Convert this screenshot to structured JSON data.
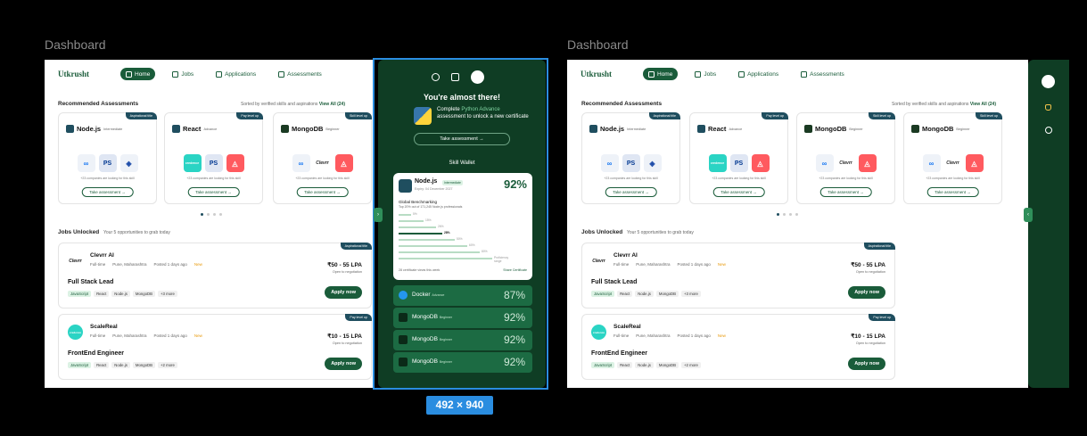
{
  "canvas_labels": [
    "Dashboard",
    "Dashboard"
  ],
  "dimension_badge": "492 × 940",
  "nav": {
    "logo": "Utkrusht",
    "items": [
      {
        "label": "Home",
        "active": true
      },
      {
        "label": "Jobs"
      },
      {
        "label": "Applications"
      },
      {
        "label": "Assessments"
      }
    ]
  },
  "recommended": {
    "title": "Recommended Assessments",
    "subtitle": "Sorted by verified skills and aspirations",
    "view_all": "View All (24)",
    "cards": [
      {
        "tag": "Aspirational title",
        "name": "Node.js",
        "level": "Intermediate",
        "logos": [
          "meta",
          "playstation",
          "shield"
        ],
        "count": "+23 companies are looking for this skill",
        "button": "Take assessment →"
      },
      {
        "tag": "Pay level up",
        "name": "React",
        "level": "Advance",
        "logos": [
          "credence",
          "playstation",
          "airbnb"
        ],
        "count": "+23 companies are looking for this skill",
        "button": "Take assessment →"
      },
      {
        "tag": "Skill level up",
        "name": "MongoDB",
        "level": "Beginner",
        "logos": [
          "meta",
          "clevrr",
          "airbnb"
        ],
        "count": "+23 companies are looking for this skill",
        "button": "Take assessment →"
      },
      {
        "tag": "Skill level up",
        "name": "MongoDB",
        "level": "Beginner",
        "logos": [
          "meta",
          "clevrr",
          "airbnb"
        ],
        "count": "+23 companies are looking for this skill",
        "button": "Take assessment →"
      }
    ]
  },
  "jobs": {
    "title": "Jobs Unlocked",
    "subtitle": "Your 5 opportunities to grab today",
    "cards": [
      {
        "tag": "Aspirational title",
        "company": "Clevrr AI",
        "logo": "Clevrr",
        "type": "Full-time",
        "location": "Pune, Maharashtra",
        "posted": "Posted 1 days ago",
        "badge": "New",
        "salary": "₹50 - 55 LPA",
        "negotiation": "Open to negotiation",
        "title": "Full Stack Lead",
        "skills": [
          "JavaScript",
          "React",
          "Node.js",
          "MongoDB",
          "+3 more"
        ],
        "button": "Apply now"
      },
      {
        "tag": "Pay level up",
        "company": "ScaleReal",
        "logo": "credence",
        "type": "Full-time",
        "location": "Pune, Maharashtra",
        "posted": "Posted 1 days ago",
        "badge": "New",
        "salary": "₹10 - 15 LPA",
        "negotiation": "Open to negotiation",
        "title": "FrontEnd Engineer",
        "skills": [
          "JavaScript",
          "React",
          "Node.js",
          "MongoDB",
          "+2 more"
        ],
        "button": "Apply now"
      }
    ]
  },
  "panel": {
    "heading": "You're almost there!",
    "promo_pre": "Complete",
    "promo_link": "Python Advance",
    "promo_post": "assessment to unlock a new certificate",
    "promo_button": "Take assessment →",
    "wallet_title": "Skill Wallet",
    "main": {
      "name": "Node.js",
      "level": "Intermediate",
      "date": "Expiry: 04 December 2027",
      "percent": "92%",
      "benchmark_title": "Global Benchmarking",
      "benchmark_sub": "Top 20% out of 171,245 Node.js professionals",
      "bars": [
        {
          "label": "5%",
          "value": 0.1
        },
        {
          "label": "15%",
          "value": 0.2
        },
        {
          "label": "26%",
          "value": 0.3
        },
        {
          "label": "28%",
          "value": 0.35,
          "me": true
        },
        {
          "label": "50%",
          "value": 0.45
        },
        {
          "label": "60%",
          "value": 0.55
        },
        {
          "label": "80%",
          "value": 0.65
        },
        {
          "label": "Proficiency range",
          "value": 0.75
        }
      ],
      "views": "28 certificate views this week",
      "share": "Share Certificate"
    },
    "rows": [
      {
        "name": "Docker",
        "level": "Advance",
        "percent": "87%",
        "icon": "docker"
      },
      {
        "name": "MongoDB",
        "level": "Beginner",
        "percent": "92%",
        "icon": "mongodb"
      },
      {
        "name": "MongoDB",
        "level": "Beginner",
        "percent": "92%",
        "icon": "mongodb"
      },
      {
        "name": "MongoDB",
        "level": "Beginner",
        "percent": "92%",
        "icon": "mongodb"
      }
    ]
  }
}
